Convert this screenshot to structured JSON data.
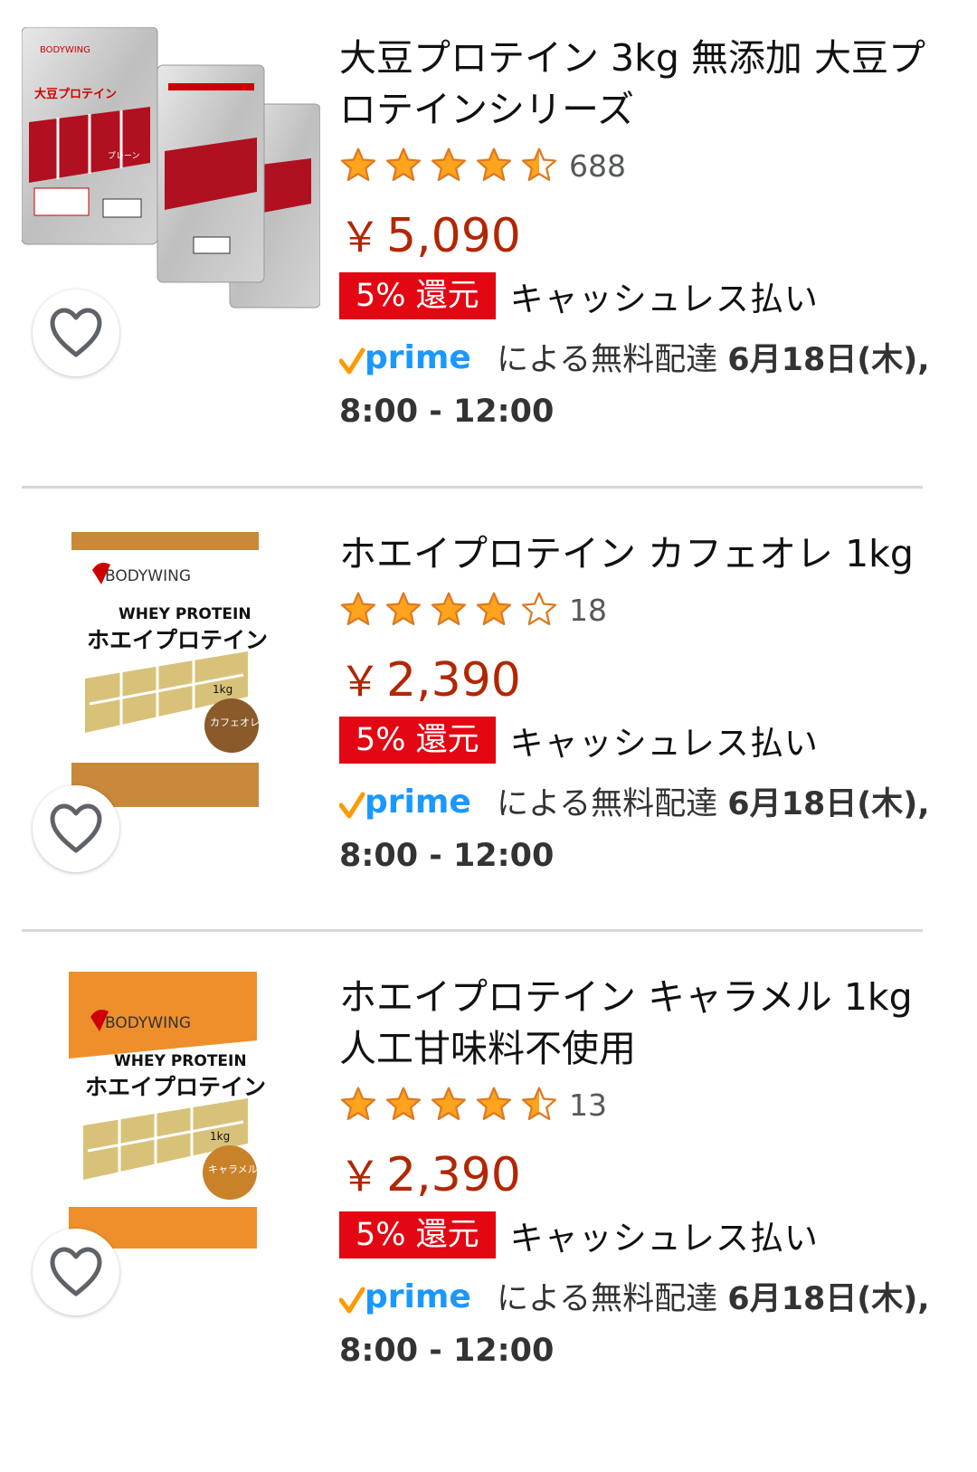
{
  "products": [
    {
      "title": "大豆プロテイン 3kg 無添加 大豆プロテインシリーズ",
      "rating": 4.5,
      "review_count": "688",
      "price_symbol": "￥",
      "price": "5,090",
      "badge": "5% 還元",
      "cashless": "キャッシュレス払い",
      "prime_logo": "prime",
      "delivery_prefix": "による無料配達",
      "delivery_date": "6月18日(木),",
      "delivery_time": "8:00 - 12:00",
      "image_icon": "soy-protein-bags-image"
    },
    {
      "title": "ホエイプロテイン カフェオレ 1kg",
      "rating": 4.0,
      "review_count": "18",
      "price_symbol": "￥",
      "price": "2,390",
      "badge": "5% 還元",
      "cashless": "キャッシュレス払い",
      "prime_logo": "prime",
      "delivery_prefix": "による無料配達",
      "delivery_date": "6月18日(木),",
      "delivery_time": "8:00 - 12:00",
      "image_icon": "whey-protein-cafe-au-lait-image",
      "pkg_brand": "BODYWING",
      "pkg_label": "WHEY PROTEIN",
      "pkg_title": "ホエイプロテイン",
      "pkg_weight": "1kg",
      "pkg_flavor": "カフェオレ"
    },
    {
      "title": "ホエイプロテイン キャラメル 1kg 人工甘味料不使用",
      "rating": 4.5,
      "review_count": "13",
      "price_symbol": "￥",
      "price": "2,390",
      "badge": "5% 還元",
      "cashless": "キャッシュレス払い",
      "prime_logo": "prime",
      "delivery_prefix": "による無料配達",
      "delivery_date": "6月18日(木),",
      "delivery_time": "8:00 - 12:00",
      "image_icon": "whey-protein-caramel-image",
      "pkg_brand": "BODYWING",
      "pkg_label": "WHEY PROTEIN",
      "pkg_title": "ホエイプロテイン",
      "pkg_weight": "1kg",
      "pkg_flavor": "キャラメル"
    }
  ],
  "soy_pkg": {
    "brand": "BODYWING",
    "title": "大豆プロテイン",
    "flavor": "プレーン"
  },
  "colors": {
    "price": "#B12704",
    "badge": "#E30613",
    "star": "#FFA41C",
    "prime_blue": "#1A98FF",
    "prime_check": "#FF9900"
  }
}
